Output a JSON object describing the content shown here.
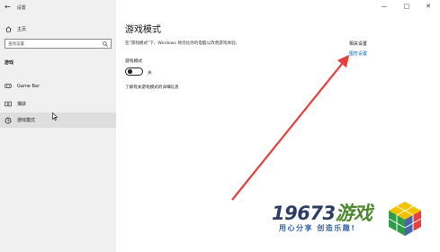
{
  "window": {
    "title": "设置",
    "back_icon": "←",
    "controls": [
      "—",
      "□",
      "✕"
    ]
  },
  "sidebar": {
    "home_label": "主页",
    "search_placeholder": "查找设置",
    "section_label": "游戏",
    "items": [
      {
        "label": "Game Bar",
        "icon": "game-bar-icon"
      },
      {
        "label": "捕获",
        "icon": "capture-icon"
      },
      {
        "label": "游戏模式",
        "icon": "game-mode-icon",
        "active": true
      }
    ]
  },
  "main": {
    "title": "游戏模式",
    "description": "在\"游戏模式\"下，Windows 将优化你的电脑以改善游戏体验。",
    "toggle": {
      "label": "游戏模式",
      "state_label": "关",
      "on": false
    },
    "more_info_link": "了解有关游戏模式的详细信息"
  },
  "related": {
    "title": "相关设置",
    "link": "图形设置"
  },
  "watermark": {
    "brand_number": "19673",
    "brand_word": "游戏",
    "slogan": "用心分享  创造乐趣!"
  },
  "colors": {
    "sidebar_bg": "#f0f0f0",
    "active_bg": "#dedede",
    "arrow": "#e8413d",
    "link": "#0063b1"
  }
}
